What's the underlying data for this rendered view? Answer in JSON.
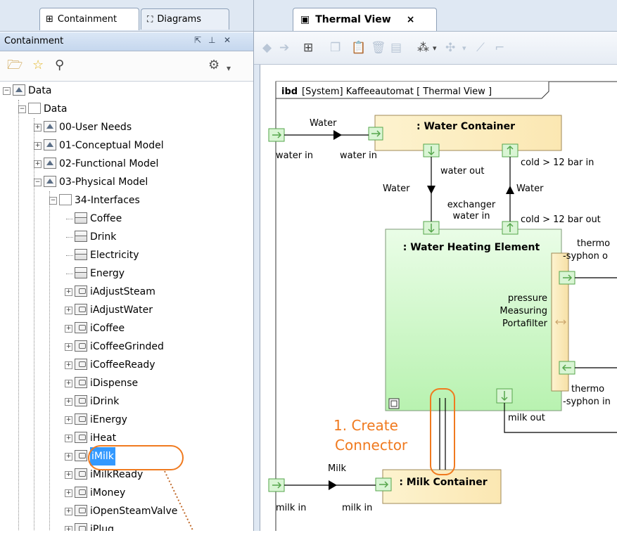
{
  "left_tabs": {
    "containment": "Containment",
    "diagrams": "Diagrams"
  },
  "pane": {
    "title": "Containment"
  },
  "tree": [
    {
      "label": "Data",
      "indent": 0,
      "icon": "package",
      "expander": "minus"
    },
    {
      "label": "Data",
      "indent": 1,
      "icon": "folder",
      "expander": "minus"
    },
    {
      "label": "00-User Needs",
      "indent": 2,
      "icon": "package",
      "expander": "plus"
    },
    {
      "label": "01-Conceptual Model",
      "indent": 2,
      "icon": "package",
      "expander": "plus"
    },
    {
      "label": "02-Functional Model",
      "indent": 2,
      "icon": "package",
      "expander": "plus"
    },
    {
      "label": "03-Physical Model",
      "indent": 2,
      "icon": "package",
      "expander": "minus"
    },
    {
      "label": "34-Interfaces",
      "indent": 3,
      "icon": "folder",
      "expander": "minus"
    },
    {
      "label": "Coffee",
      "indent": 4,
      "icon": "block",
      "expander": "none"
    },
    {
      "label": "Drink",
      "indent": 4,
      "icon": "block",
      "expander": "none"
    },
    {
      "label": "Electricity",
      "indent": 4,
      "icon": "block",
      "expander": "none"
    },
    {
      "label": "Energy",
      "indent": 4,
      "icon": "block",
      "expander": "none"
    },
    {
      "label": "iAdjustSteam",
      "indent": 4,
      "icon": "interface",
      "expander": "plus"
    },
    {
      "label": "iAdjustWater",
      "indent": 4,
      "icon": "interface",
      "expander": "plus"
    },
    {
      "label": "iCoffee",
      "indent": 4,
      "icon": "interface",
      "expander": "plus"
    },
    {
      "label": "iCoffeeGrinded",
      "indent": 4,
      "icon": "interface",
      "expander": "plus"
    },
    {
      "label": "iCoffeeReady",
      "indent": 4,
      "icon": "interface",
      "expander": "plus"
    },
    {
      "label": "iDispense",
      "indent": 4,
      "icon": "interface",
      "expander": "plus"
    },
    {
      "label": "iDrink",
      "indent": 4,
      "icon": "interface",
      "expander": "plus"
    },
    {
      "label": "iEnergy",
      "indent": 4,
      "icon": "interface",
      "expander": "plus"
    },
    {
      "label": "iHeat",
      "indent": 4,
      "icon": "interface",
      "expander": "plus"
    },
    {
      "label": "iMilk",
      "indent": 4,
      "icon": "interface",
      "expander": "plus",
      "selected": true
    },
    {
      "label": "iMilkReady",
      "indent": 4,
      "icon": "interface",
      "expander": "plus"
    },
    {
      "label": "iMoney",
      "indent": 4,
      "icon": "interface",
      "expander": "plus"
    },
    {
      "label": "iOpenSteamValve",
      "indent": 4,
      "icon": "interface",
      "expander": "plus"
    },
    {
      "label": "iPlug",
      "indent": 4,
      "icon": "interface",
      "expander": "plus"
    }
  ],
  "editor": {
    "tab_label": "Thermal View",
    "close": "×"
  },
  "diagram": {
    "frame_kind": "ibd",
    "frame_title": "[System] Kaffeeautomat [ Thermal View ]",
    "water_container": ": Water Container",
    "heating_element": ": Water Heating Element",
    "milk_container": ": Milk Container",
    "labels": {
      "water_top": "Water",
      "water_in_left": "water in",
      "water_in_right": "water in",
      "water_out": "water out",
      "cold_in": "cold > 12 bar in",
      "water_down": "Water",
      "water_up": "Water",
      "exchanger_1": "exchanger",
      "exchanger_2": "water in",
      "cold_out": "cold > 12 bar out",
      "thermo_top_1": "thermo",
      "thermo_top_2": "-syphon o",
      "pressure_1": "pressure",
      "pressure_2": "Measuring",
      "pressure_3": "Portafilter",
      "thermo_bot_1": "thermo",
      "thermo_bot_2": "-syphon in",
      "milk_out": "milk out",
      "milk": "Milk",
      "milk_in_left": "milk in",
      "milk_in_right": "milk in"
    },
    "annotation_1": "1. Create",
    "annotation_2": "Connector"
  },
  "colors": {
    "annotation": "#f07a1f",
    "selection": "#3399ff"
  }
}
